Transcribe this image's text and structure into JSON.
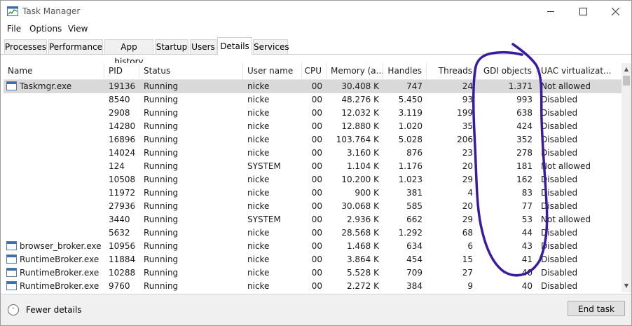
{
  "window": {
    "title": "Task Manager",
    "icon": "task-manager-icon"
  },
  "menu": [
    "File",
    "Options",
    "View"
  ],
  "tabs": [
    {
      "label": "Processes",
      "active": false
    },
    {
      "label": "Performance",
      "active": false
    },
    {
      "label": "App history",
      "active": false
    },
    {
      "label": "Startup",
      "active": false
    },
    {
      "label": "Users",
      "active": false
    },
    {
      "label": "Details",
      "active": true
    },
    {
      "label": "Services",
      "active": false
    }
  ],
  "columns": [
    "Name",
    "PID",
    "Status",
    "User name",
    "CPU",
    "Memory (a...",
    "Handles",
    "Threads",
    "GDI objects",
    "UAC virtualizat..."
  ],
  "sorted_column": "GDI objects",
  "rows": [
    {
      "name": "Taskmgr.exe",
      "pid": "19136",
      "status": "Running",
      "user": "nicke",
      "cpu": "00",
      "memory": "30.408 K",
      "handles": "747",
      "threads": "24",
      "gdi": "1.371",
      "uac": "Not allowed",
      "selected": true,
      "icon": "taskmgr-icon"
    },
    {
      "name": "",
      "pid": "8540",
      "status": "Running",
      "user": "nicke",
      "cpu": "00",
      "memory": "48.276 K",
      "handles": "5.450",
      "threads": "93",
      "gdi": "993",
      "uac": "Disabled"
    },
    {
      "name": "",
      "pid": "2908",
      "status": "Running",
      "user": "nicke",
      "cpu": "00",
      "memory": "12.032 K",
      "handles": "3.119",
      "threads": "199",
      "gdi": "638",
      "uac": "Disabled"
    },
    {
      "name": "",
      "pid": "14280",
      "status": "Running",
      "user": "nicke",
      "cpu": "00",
      "memory": "12.880 K",
      "handles": "1.020",
      "threads": "35",
      "gdi": "424",
      "uac": "Disabled"
    },
    {
      "name": "",
      "pid": "16896",
      "status": "Running",
      "user": "nicke",
      "cpu": "00",
      "memory": "103.764 K",
      "handles": "5.028",
      "threads": "206",
      "gdi": "352",
      "uac": "Disabled"
    },
    {
      "name": "",
      "pid": "14024",
      "status": "Running",
      "user": "nicke",
      "cpu": "00",
      "memory": "3.160 K",
      "handles": "876",
      "threads": "23",
      "gdi": "278",
      "uac": "Disabled"
    },
    {
      "name": "",
      "pid": "124",
      "status": "Running",
      "user": "SYSTEM",
      "cpu": "00",
      "memory": "1.104 K",
      "handles": "1.176",
      "threads": "20",
      "gdi": "181",
      "uac": "Not allowed"
    },
    {
      "name": "",
      "pid": "10508",
      "status": "Running",
      "user": "nicke",
      "cpu": "00",
      "memory": "10.200 K",
      "handles": "1.023",
      "threads": "29",
      "gdi": "162",
      "uac": "Disabled"
    },
    {
      "name": "",
      "pid": "11972",
      "status": "Running",
      "user": "nicke",
      "cpu": "00",
      "memory": "900 K",
      "handles": "381",
      "threads": "4",
      "gdi": "83",
      "uac": "Disabled"
    },
    {
      "name": "",
      "pid": "27936",
      "status": "Running",
      "user": "nicke",
      "cpu": "00",
      "memory": "30.068 K",
      "handles": "585",
      "threads": "20",
      "gdi": "77",
      "uac": "Disabled"
    },
    {
      "name": "",
      "pid": "3440",
      "status": "Running",
      "user": "SYSTEM",
      "cpu": "00",
      "memory": "2.936 K",
      "handles": "662",
      "threads": "29",
      "gdi": "53",
      "uac": "Not allowed"
    },
    {
      "name": "",
      "pid": "5632",
      "status": "Running",
      "user": "nicke",
      "cpu": "00",
      "memory": "28.568 K",
      "handles": "1.292",
      "threads": "68",
      "gdi": "44",
      "uac": "Disabled"
    },
    {
      "name": "browser_broker.exe",
      "pid": "10956",
      "status": "Running",
      "user": "nicke",
      "cpu": "00",
      "memory": "1.468 K",
      "handles": "634",
      "threads": "6",
      "gdi": "43",
      "uac": "Disabled",
      "icon": "app-window-icon"
    },
    {
      "name": "RuntimeBroker.exe",
      "pid": "11884",
      "status": "Running",
      "user": "nicke",
      "cpu": "00",
      "memory": "3.864 K",
      "handles": "454",
      "threads": "15",
      "gdi": "41",
      "uac": "Disabled",
      "icon": "app-window-icon"
    },
    {
      "name": "RuntimeBroker.exe",
      "pid": "10288",
      "status": "Running",
      "user": "nicke",
      "cpu": "00",
      "memory": "5.528 K",
      "handles": "709",
      "threads": "27",
      "gdi": "40",
      "uac": "Disabled",
      "icon": "app-window-icon"
    },
    {
      "name": "RuntimeBroker.exe",
      "pid": "9760",
      "status": "Running",
      "user": "nicke",
      "cpu": "00",
      "memory": "2.272 K",
      "handles": "384",
      "threads": "9",
      "gdi": "40",
      "uac": "Disabled",
      "icon": "app-window-icon"
    }
  ],
  "footer": {
    "fewer_details": "Fewer details",
    "end_task": "End task"
  },
  "annotation": {
    "shape": "hand-drawn circle around GDI objects column",
    "color": "#3a1a9e"
  },
  "colors": {
    "selected_row": "#d9d9d9",
    "tab_bg": "#f0f0f0",
    "footer_bg": "#f0f0f0"
  }
}
